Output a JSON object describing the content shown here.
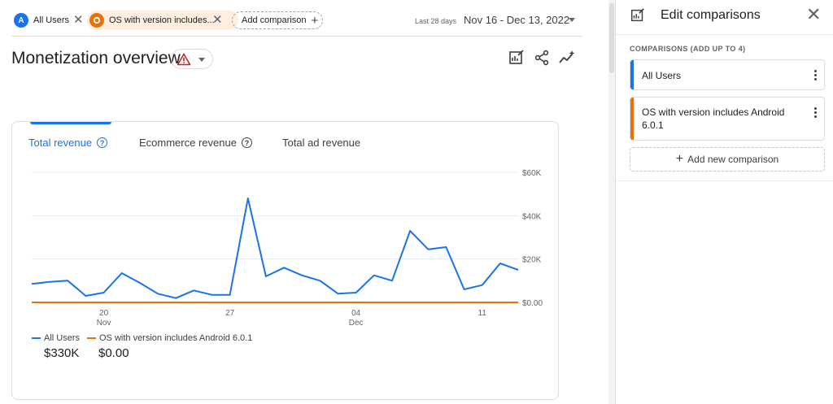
{
  "topbar": {
    "chip_all_users": {
      "badge": "A",
      "label": "All Users"
    },
    "chip_os": {
      "label": "OS with version includes..."
    },
    "add_comparison": "Add comparison",
    "range_caption": "Last 28 days",
    "range": "Nov 16 - Dec 13, 2022"
  },
  "page": {
    "title": "Monetization overview"
  },
  "card": {
    "tabs": [
      {
        "label": "Total revenue",
        "active": true
      },
      {
        "label": "Ecommerce revenue",
        "active": false
      },
      {
        "label": "Total ad revenue",
        "active": false
      }
    ],
    "legend": [
      {
        "name": "All Users",
        "total": "$330K",
        "color": "#1a73e8"
      },
      {
        "name": "OS with version includes Android 6.0.1",
        "total": "$0.00",
        "color": "#e8710a"
      }
    ]
  },
  "chart_data": {
    "type": "line",
    "x_tick_labels": [
      {
        "day": "20",
        "month": "Nov"
      },
      {
        "day": "27",
        "month": ""
      },
      {
        "day": "04",
        "month": "Dec"
      },
      {
        "day": "11",
        "month": ""
      }
    ],
    "y_tick_labels": [
      "$60K",
      "$40K",
      "$20K",
      "$0.00"
    ],
    "ylim": [
      0,
      60000
    ],
    "x": [
      "Nov 16",
      "Nov 17",
      "Nov 18",
      "Nov 19",
      "Nov 20",
      "Nov 21",
      "Nov 22",
      "Nov 23",
      "Nov 24",
      "Nov 25",
      "Nov 26",
      "Nov 27",
      "Nov 28",
      "Nov 29",
      "Nov 30",
      "Dec 1",
      "Dec 2",
      "Dec 3",
      "Dec 4",
      "Dec 5",
      "Dec 6",
      "Dec 7",
      "Dec 8",
      "Dec 9",
      "Dec 10",
      "Dec 11",
      "Dec 12",
      "Dec 13"
    ],
    "series": [
      {
        "name": "All Users",
        "color": "#1a73e8",
        "values": [
          8500,
          9500,
          10000,
          3000,
          4500,
          13500,
          9000,
          4000,
          2000,
          5500,
          3500,
          3500,
          48000,
          12000,
          16000,
          12500,
          10000,
          4000,
          4500,
          12500,
          10000,
          33000,
          24500,
          25500,
          6000,
          8000,
          18000,
          15000
        ]
      },
      {
        "name": "OS with version includes Android 6.0.1",
        "color": "#e8710a",
        "values": [
          0,
          0,
          0,
          0,
          0,
          0,
          0,
          0,
          0,
          0,
          0,
          0,
          0,
          0,
          0,
          0,
          0,
          0,
          0,
          0,
          0,
          0,
          0,
          0,
          0,
          0,
          0,
          0
        ]
      }
    ],
    "grid": true,
    "legend_position": "bottom-left"
  },
  "panel": {
    "title": "Edit comparisons",
    "section": "COMPARISONS (ADD UP TO 4)",
    "comparisons": [
      {
        "label": "All Users",
        "color": "#1a73e8"
      },
      {
        "label": "OS with version includes Android 6.0.1",
        "color": "#e8710a"
      }
    ],
    "add_new": "Add new comparison"
  },
  "icons": {
    "warning": "warning-icon",
    "customize": "customize-report-icon",
    "share": "share-icon",
    "insights": "insights-icon",
    "close": "close-icon"
  }
}
